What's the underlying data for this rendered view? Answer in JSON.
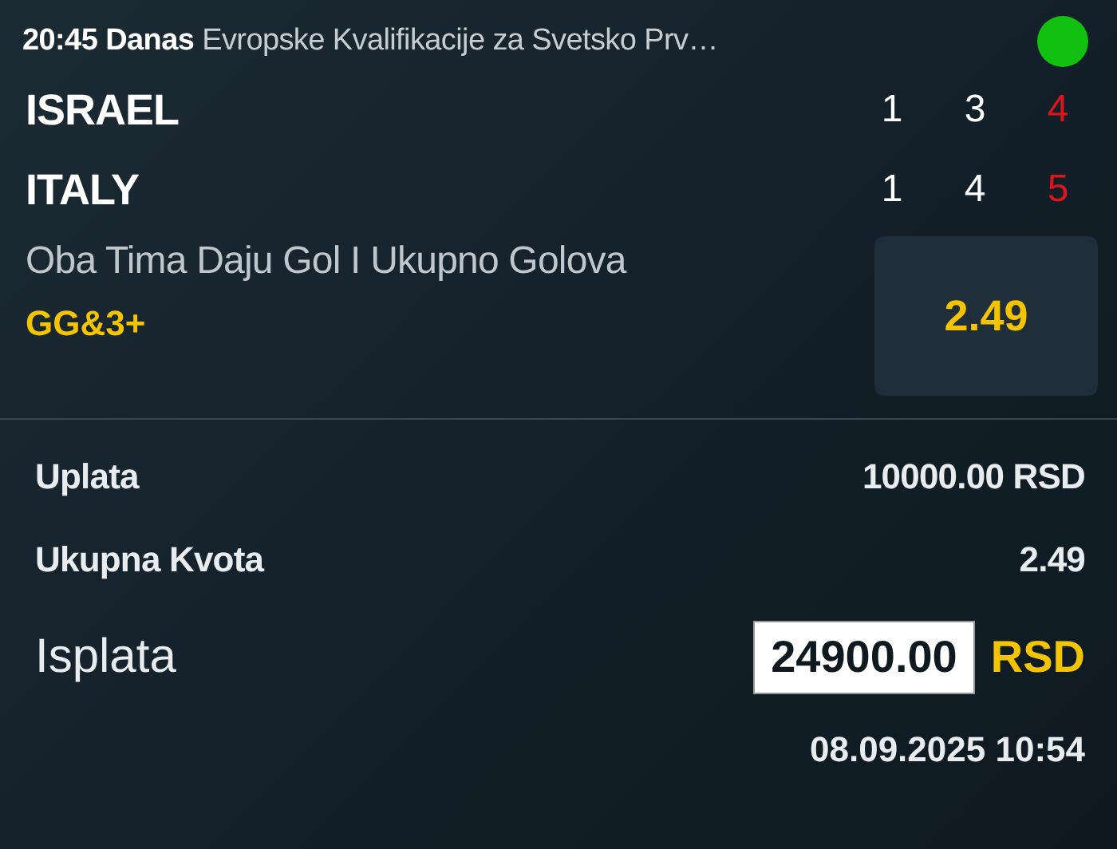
{
  "header": {
    "time": "20:45 Danas",
    "competition": "Evropske Kvalifikacije za Svetsko Prv…",
    "live": true
  },
  "teams": [
    {
      "name": "ISRAEL",
      "scores": [
        {
          "value": "1",
          "kind": "period"
        },
        {
          "value": "3",
          "kind": "period"
        },
        {
          "value": "4",
          "kind": "total"
        }
      ]
    },
    {
      "name": "ITALY",
      "scores": [
        {
          "value": "1",
          "kind": "period"
        },
        {
          "value": "4",
          "kind": "period"
        },
        {
          "value": "5",
          "kind": "total"
        }
      ]
    }
  ],
  "bet": {
    "market": "Oba Tima Daju Gol I Ukupno Golova",
    "pick": "GG&3+",
    "odds": "2.49"
  },
  "summary": [
    {
      "label": "Uplata",
      "value": "10000.00 RSD"
    },
    {
      "label": "Ukupna Kvota",
      "value": "2.49"
    }
  ],
  "payout": {
    "label": "Isplata",
    "amount": "24900.00",
    "currency": "RSD"
  },
  "timestamp": "08.09.2025 10:54"
}
